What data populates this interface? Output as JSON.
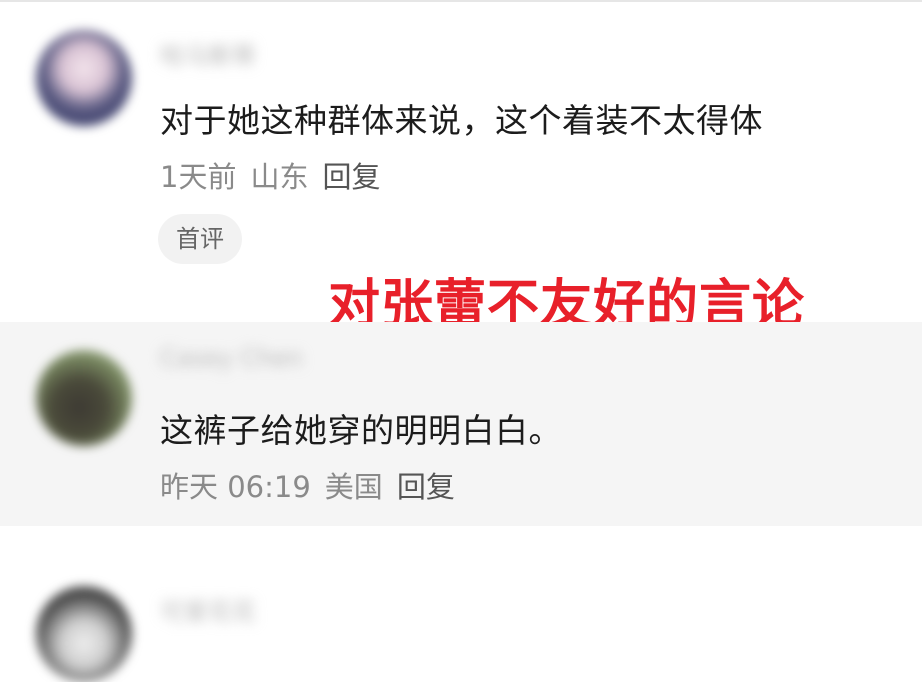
{
  "comments": [
    {
      "username": "哈马斯蒂",
      "text": "对于她这种群体来说，这个着装不太得体",
      "time": "1天前",
      "location": "山东",
      "reply_label": "回复",
      "badge": "首评"
    },
    {
      "username": "Casey Chen",
      "text": "这裤子给她穿的明明白白。",
      "time": "昨天 06:19",
      "location": "美国",
      "reply_label": "回复"
    },
    {
      "username": "可爱花花"
    }
  ],
  "annotation": {
    "text": "对张蕾不友好的言论",
    "color": "#e8202a"
  },
  "colors": {
    "highlight_background": "#f5f5f5",
    "meta_text": "#8a8a8a",
    "comment_text": "#1c1c1c"
  }
}
